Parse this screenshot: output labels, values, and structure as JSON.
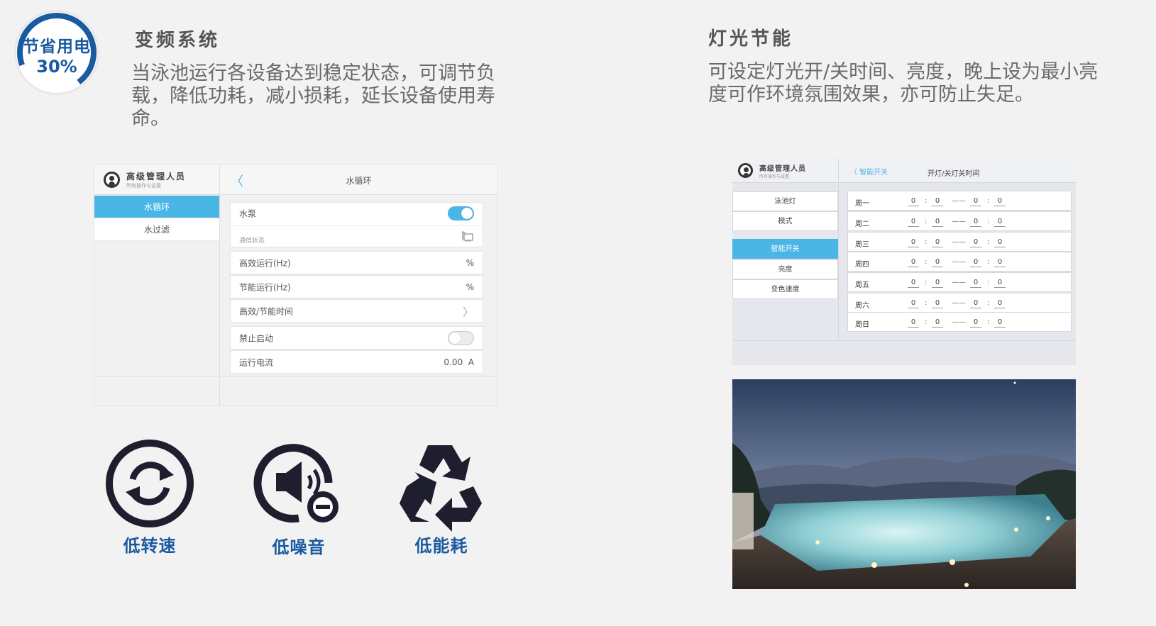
{
  "badge": {
    "line1": "节省用电",
    "line2": "30%"
  },
  "left_section": {
    "title": "变频系统",
    "desc_lines": [
      "当泳池运行各设备达到稳定状态，可调节负",
      "载，降低功耗，减小损耗，延长设备使用寿",
      "命。"
    ]
  },
  "right_section": {
    "title": "灯光节能",
    "desc_lines": [
      "可设定灯光开/关时间、亮度，晚上设为最小亮",
      "度可作环境氛围效果，亦可防止失足。"
    ]
  },
  "left_panel": {
    "user_name": "高级管理人员",
    "user_sub": "所有操作与设置",
    "back": "〈",
    "header_title": "水循环",
    "side_items": [
      "水循环",
      "水过滤"
    ],
    "rows": {
      "pump_label": "水泵",
      "comm_status": "通信状态",
      "high_eff_label": "高效运行(Hz)",
      "high_eff_unit": "%",
      "energy_label": "节能运行(Hz)",
      "energy_unit": "%",
      "time_label": "高效/节能时间",
      "disable_label": "禁止启动",
      "current_label": "运行电流",
      "current_value": "0.00",
      "current_unit": "A"
    }
  },
  "icons": {
    "low_speed": "低转速",
    "low_noise": "低噪音",
    "low_energy": "低能耗"
  },
  "right_panel": {
    "user_name": "高级管理人员",
    "user_sub": "所有操作与设置",
    "back": "〈  智能开关",
    "header_title": "开灯/关灯关时间",
    "side_items": [
      "泳池灯",
      "模式",
      "智能开关",
      "亮度",
      "变色速度"
    ],
    "days": [
      "周一",
      "周二",
      "周三",
      "周四",
      "周五",
      "周六",
      "周日"
    ],
    "on_hour": "0",
    "on_min": "0",
    "off_hour": "0",
    "off_min": "0",
    "colon": ":",
    "dash": "——"
  },
  "colors": {
    "accent": "#4ab6e6",
    "brand": "#1a5aa0"
  }
}
